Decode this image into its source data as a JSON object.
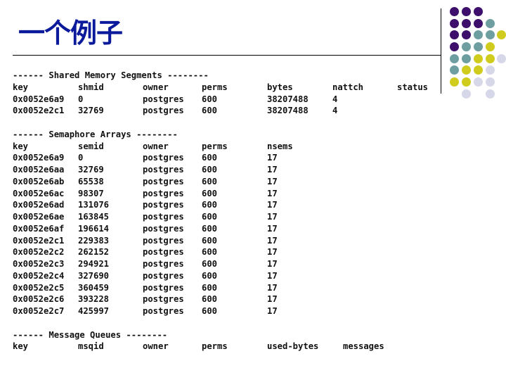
{
  "title": "一个例子",
  "colors": {
    "title": "#0a1a9a",
    "purple": "#3d0f6b",
    "teal": "#6e9ea0",
    "yellow": "#cfcc1e",
    "lavender": "#d7d7ea"
  },
  "decoration": {
    "dot_rows": [
      [
        "purple",
        "purple",
        "purple",
        null,
        null
      ],
      [
        "purple",
        "purple",
        "purple",
        "teal",
        null
      ],
      [
        "purple",
        "purple",
        "teal",
        "teal",
        "yellow"
      ],
      [
        "purple",
        "teal",
        "teal",
        "yellow",
        null
      ],
      [
        "teal",
        "teal",
        "yellow",
        "yellow",
        "lavender"
      ],
      [
        "teal",
        "yellow",
        "yellow",
        "lavender",
        null
      ],
      [
        "yellow",
        "yellow",
        "lavender",
        "lavender",
        null
      ],
      [
        null,
        "lavender",
        null,
        "lavender",
        null
      ]
    ]
  },
  "shared_memory": {
    "header": "------ Shared Memory Segments --------",
    "columns": [
      "key",
      "shmid",
      "owner",
      "perms",
      "bytes",
      "nattch",
      "status"
    ],
    "rows": [
      [
        "0x0052e6a9",
        "0",
        "postgres",
        "600",
        "38207488",
        "4",
        ""
      ],
      [
        "0x0052e2c1",
        "32769",
        "postgres",
        "600",
        "38207488",
        "4",
        ""
      ]
    ]
  },
  "semaphores": {
    "header": "------ Semaphore Arrays --------",
    "columns": [
      "key",
      "semid",
      "owner",
      "perms",
      "nsems"
    ],
    "rows": [
      [
        "0x0052e6a9",
        "0",
        "postgres",
        "600",
        "17"
      ],
      [
        "0x0052e6aa",
        "32769",
        "postgres",
        "600",
        "17"
      ],
      [
        "0x0052e6ab",
        "65538",
        "postgres",
        "600",
        "17"
      ],
      [
        "0x0052e6ac",
        "98307",
        "postgres",
        "600",
        "17"
      ],
      [
        "0x0052e6ad",
        "131076",
        "postgres",
        "600",
        "17"
      ],
      [
        "0x0052e6ae",
        "163845",
        "postgres",
        "600",
        "17"
      ],
      [
        "0x0052e6af",
        "196614",
        "postgres",
        "600",
        "17"
      ],
      [
        "0x0052e2c1",
        "229383",
        "postgres",
        "600",
        "17"
      ],
      [
        "0x0052e2c2",
        "262152",
        "postgres",
        "600",
        "17"
      ],
      [
        "0x0052e2c3",
        "294921",
        "postgres",
        "600",
        "17"
      ],
      [
        "0x0052e2c4",
        "327690",
        "postgres",
        "600",
        "17"
      ],
      [
        "0x0052e2c5",
        "360459",
        "postgres",
        "600",
        "17"
      ],
      [
        "0x0052e2c6",
        "393228",
        "postgres",
        "600",
        "17"
      ],
      [
        "0x0052e2c7",
        "425997",
        "postgres",
        "600",
        "17"
      ]
    ]
  },
  "message_queues": {
    "header": "------ Message Queues --------",
    "columns": [
      "key",
      "msqid",
      "owner",
      "perms",
      "used-bytes",
      "messages"
    ],
    "rows": []
  }
}
